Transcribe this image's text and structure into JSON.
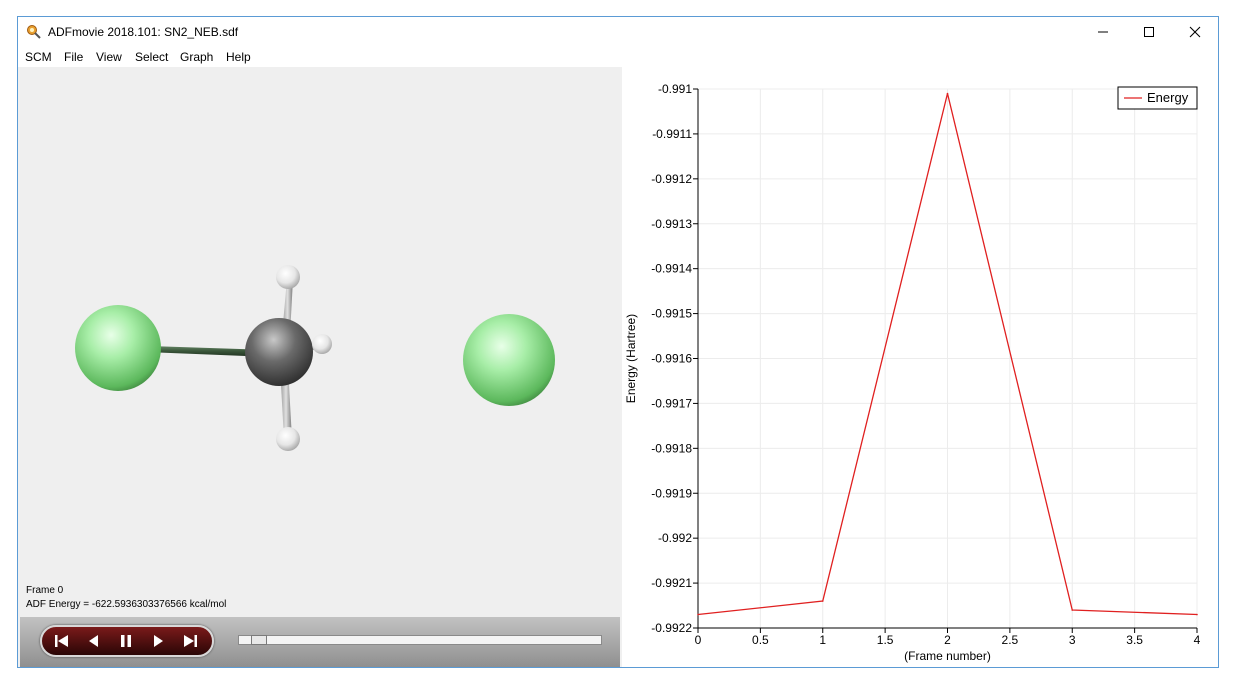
{
  "window": {
    "title": "ADFmovie 2018.101: SN2_NEB.sdf",
    "controls": [
      "minimize-icon",
      "maximize-icon",
      "close-icon"
    ]
  },
  "menu": [
    "SCM",
    "File",
    "View",
    "Select",
    "Graph",
    "Help"
  ],
  "viewer": {
    "frame_label": "Frame 0",
    "energy_label": "ADF Energy = -622.5936303376566 kcal/mol",
    "atom_colors": {
      "chlorine": "#8fe08f",
      "carbon": "#4a4a4a",
      "hydrogen": "#f2f2f2",
      "bond": "#3f5c3f"
    }
  },
  "playback": {
    "buttons": [
      "skip-start-icon",
      "step-back-icon",
      "pause-icon",
      "play-icon",
      "skip-end-icon"
    ],
    "slider_position": 0
  },
  "chart_data": {
    "type": "line",
    "title": "",
    "xlabel": "(Frame number)",
    "ylabel": "Energy (Hartree)",
    "xlim": [
      0,
      4
    ],
    "ylim": [
      -0.9922,
      -0.991
    ],
    "xticks": [
      0,
      0.5,
      1,
      1.5,
      2,
      2.5,
      3,
      3.5,
      4
    ],
    "xtick_labels": [
      "0",
      "0.5",
      "1",
      "1.5",
      "2",
      "2.5",
      "3",
      "3.5",
      "4"
    ],
    "yticks": [
      -0.991,
      -0.9911,
      -0.9912,
      -0.9913,
      -0.9914,
      -0.9915,
      -0.9916,
      -0.9917,
      -0.9918,
      -0.9919,
      -0.992,
      -0.9921,
      -0.9922
    ],
    "ytick_labels": [
      "-0.991",
      "-0.9911",
      "-0.9912",
      "-0.9913",
      "-0.9914",
      "-0.9915",
      "-0.9916",
      "-0.9917",
      "-0.9918",
      "-0.9919",
      "-0.992",
      "-0.9921",
      "-0.9922"
    ],
    "grid": true,
    "legend": "top-right",
    "series": [
      {
        "name": "Energy",
        "color": "#e02020",
        "x": [
          0,
          1,
          2,
          3,
          4
        ],
        "y": [
          -0.99217,
          -0.99214,
          -0.99101,
          -0.99216,
          -0.99217
        ]
      }
    ]
  }
}
